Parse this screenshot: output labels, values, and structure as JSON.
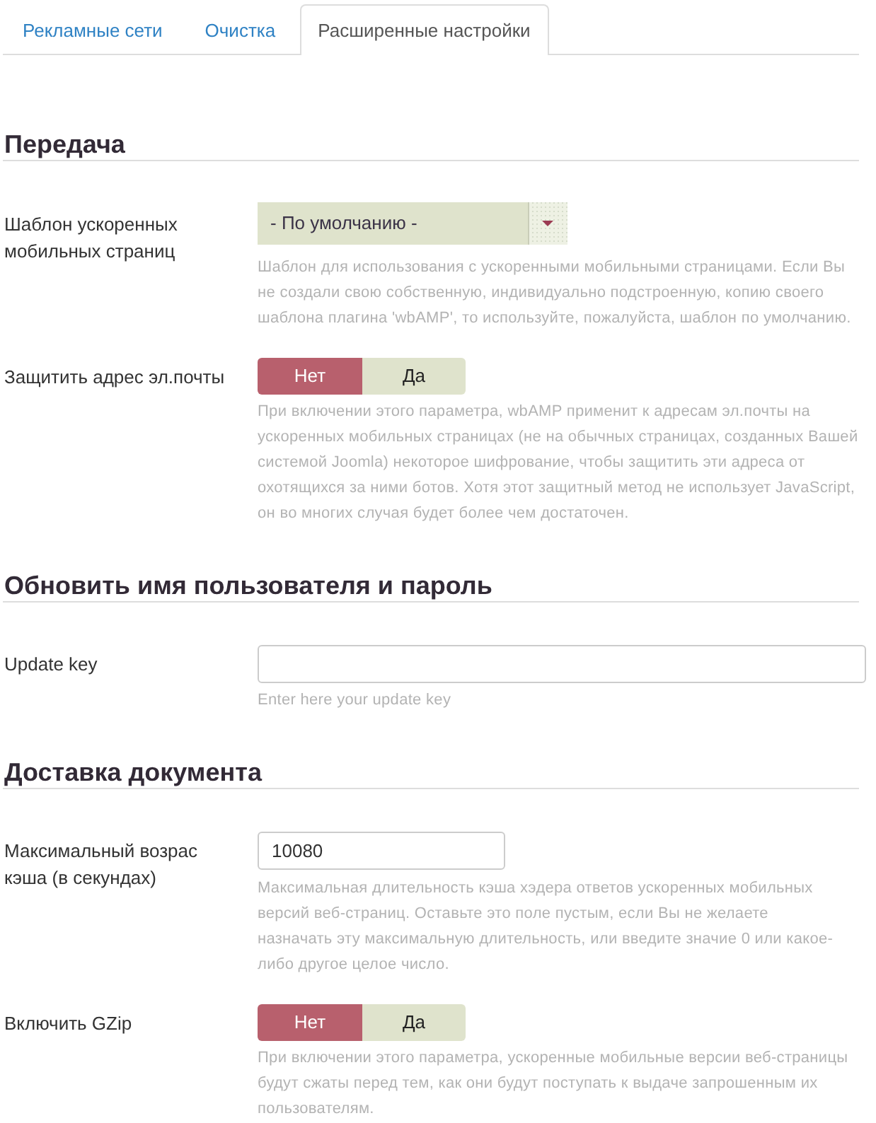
{
  "tabs": [
    {
      "label": "Рекламные сети",
      "selected": false
    },
    {
      "label": "Очистка",
      "selected": false
    },
    {
      "label": "Расширенные настройки",
      "selected": true
    }
  ],
  "sections": [
    {
      "title": "Передача",
      "fields": [
        {
          "kind": "select",
          "label": "Шаблон ускоренных мобильных страниц",
          "value": "- По умолчанию -",
          "description": "Шаблон для использования с ускоренными мобильными страницами. Если Вы не создали свою собственную, индивидуально подстроенную, копию своего шаблона плагина 'wbAMP', то используйте, пожалуйста, шаблон по умолчанию."
        },
        {
          "kind": "toggle",
          "label": "Защитить адрес эл.почты",
          "options": [
            {
              "label": "Нет",
              "selected": true
            },
            {
              "label": "Да",
              "selected": false
            }
          ],
          "description": "При включении этого параметра, wbAMP применит к адресам эл.почты на ускоренных мобильных страницах (не на обычных страницах, созданных Вашей системой Joomla) некоторое шифрование, чтобы защитить эти адреса от охотящихся за ними ботов. Хотя этот защитный метод не использует JavaScript, он во многих случая будет более чем достаточен."
        }
      ]
    },
    {
      "title": "Обновить имя пользователя и пароль",
      "fields": [
        {
          "kind": "text",
          "label": "Update key",
          "description": "Enter here your update key"
        }
      ]
    },
    {
      "title": "Доставка документа",
      "fields": [
        {
          "kind": "text",
          "label": "Максимальный возрас кэша (в секундах)",
          "value": "10080",
          "description": "Максимальная длительность кэша хэдера ответов ускоренных мобильных версий веб-страниц. Оставьте это поле пустым, если Вы не желаете назначать эту максимальную длительность, или введите значие 0 или какое-либо другое целое число."
        },
        {
          "kind": "toggle",
          "label": "Включить GZip",
          "options": [
            {
              "label": "Нет",
              "selected": true
            },
            {
              "label": "Да",
              "selected": false
            }
          ],
          "description": "При включении этого параметра, ускоренные мобильные версии веб-страницы будут сжаты перед тем, как они будут поступать к выдаче запрошенным их пользователям."
        }
      ]
    }
  ]
}
